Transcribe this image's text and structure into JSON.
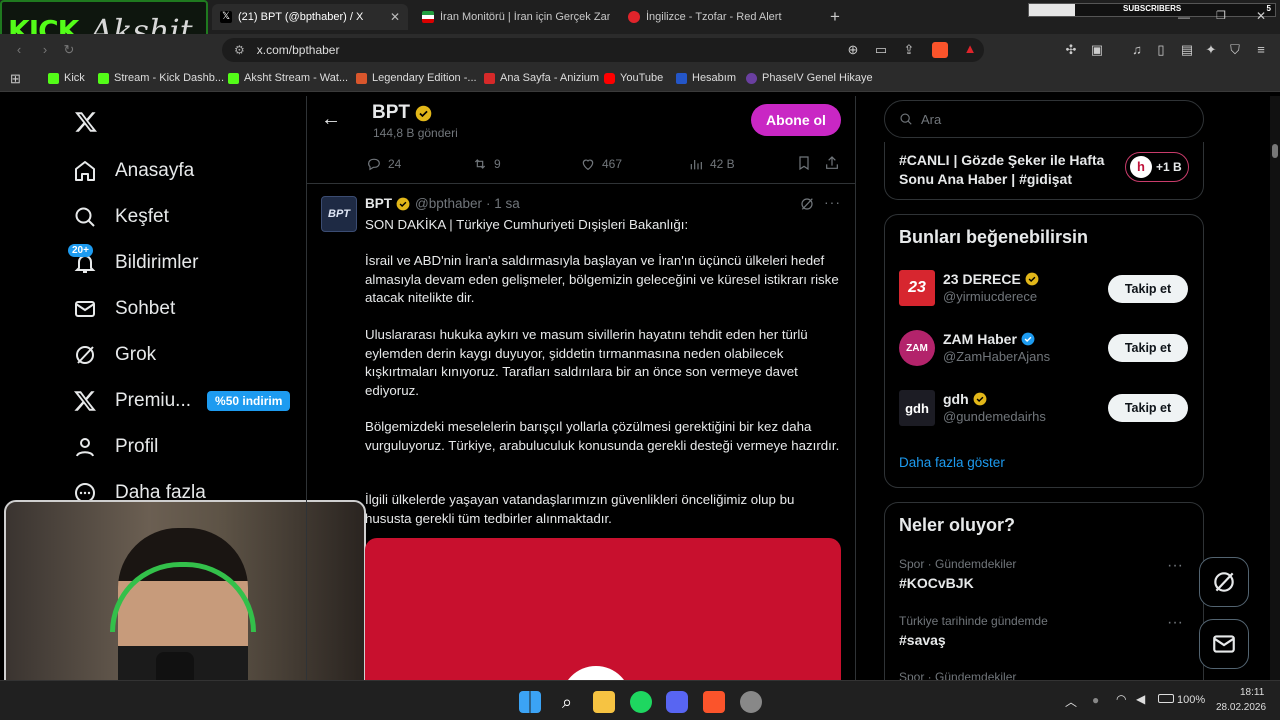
{
  "browser": {
    "overlay_title": "Akshit",
    "overlay_logo": "KICK",
    "tabs": [
      {
        "label": "(21) BPT (@bpthaber) / X",
        "icon": "x-logo-icon"
      },
      {
        "label": "İran Monitörü | İran için Gerçek Zam",
        "icon": "iran-flag-icon"
      },
      {
        "label": "İngilizce - Tzofar - Red Alert",
        "icon": "red-alert-icon"
      }
    ],
    "new_tab": "+",
    "subscribers_label": "SUBSCRIBERS",
    "subscribers_count": "5",
    "url": "x.com/bpthaber",
    "bookmarks": [
      "Kick",
      "Stream - Kick Dashb...",
      "Aksht Stream - Wat...",
      "Legendary Edition -...",
      "Ana Sayfa - Anizium",
      "YouTube",
      "Hesabım",
      "PhaseIV Genel Hikaye"
    ]
  },
  "nav": {
    "items": [
      {
        "label": "Anasayfa",
        "icon": "home-icon"
      },
      {
        "label": "Keşfet",
        "icon": "search-icon"
      },
      {
        "label": "Bildirimler",
        "icon": "bell-icon",
        "badge": "20+"
      },
      {
        "label": "Sohbet",
        "icon": "mail-icon"
      },
      {
        "label": "Grok",
        "icon": "grok-icon"
      },
      {
        "label": "Premiu...",
        "icon": "x-premium-icon",
        "promo": "%50 indirim"
      },
      {
        "label": "Profil",
        "icon": "person-icon"
      },
      {
        "label": "Daha fazla",
        "icon": "more-icon"
      }
    ]
  },
  "profile_header": {
    "name": "BPT",
    "posts": "144,8 B gönderi",
    "subscribe": "Abone ol"
  },
  "prev_stats": {
    "replies": "24",
    "reposts": "9",
    "likes": "467",
    "views": "42 B"
  },
  "tweet": {
    "avatar_text": "BPT",
    "name": "BPT",
    "handle": "@bpthaber",
    "time": "· 1 sa",
    "paragraphs": [
      "SON DAKİKA | Türkiye Cumhuriyeti Dışişleri Bakanlığı:",
      "İsrail ve ABD'nin İran'a saldırmasıyla başlayan ve İran'ın üçüncü ülkeleri hedef almasıyla devam eden gelişmeler, bölgemizin geleceğini ve küresel istikrarı riske atacak nitelikte dir.",
      "Uluslararası hukuka aykırı ve masum sivillerin hayatını tehdit eden her türlü eylemden derin kaygı duyuyor, şiddetin tırmanmasına neden olabilecek kışkırtmaları kınıyoruz. Tarafları saldırılara bir an önce son vermeye davet ediyoruz.",
      "Bölgemizdeki meselelerin barışçıl yollarla çözülmesi gerektiğini bir kez daha vurguluyoruz. Türkiye, arabuluculuk konusunda gerekli desteği vermeye hazırdır.",
      "İlgili ülkelerde yaşayan vatandaşlarımızın güvenlikleri önceliğimiz olup bu hususta gerekli tüm tedbirler alınmaktadır."
    ]
  },
  "right": {
    "search_placeholder": "Ara",
    "live": {
      "text": "#CANLI | Gözde Şeker ile Hafta Sonu Ana Haber | #gidişat",
      "count": "+1 B"
    },
    "suggestions_title": "Bunları beğenebilirsin",
    "suggestions": [
      {
        "name": "23 DERECE",
        "handle": "@yirmiucderece",
        "avatar": "23",
        "verified": "gold",
        "follow": "Takip et"
      },
      {
        "name": "ZAM Haber",
        "handle": "@ZamHaberAjans",
        "avatar": "ZAM",
        "verified": "blue",
        "follow": "Takip et"
      },
      {
        "name": "gdh",
        "handle": "@gundemedairhs",
        "avatar": "gdh",
        "verified": "gold",
        "follow": "Takip et"
      }
    ],
    "show_more": "Daha fazla göster",
    "trends_title": "Neler oluyor?",
    "trends": [
      {
        "context": "Spor · Gündemdekiler",
        "tag": "#KOCvBJK"
      },
      {
        "context": "Türkiye tarihinde gündemde",
        "tag": "#savaş"
      },
      {
        "context": "Spor · Gündemdekiler",
        "tag": ""
      }
    ]
  },
  "taskbar": {
    "battery": "100%",
    "time": "18:11",
    "date": "28.02.2026"
  },
  "colors": {
    "accent_pink": "#c927c4",
    "gold_check": "#e2b719",
    "blue_check": "#1d9bf0",
    "link": "#1d9bf0"
  }
}
